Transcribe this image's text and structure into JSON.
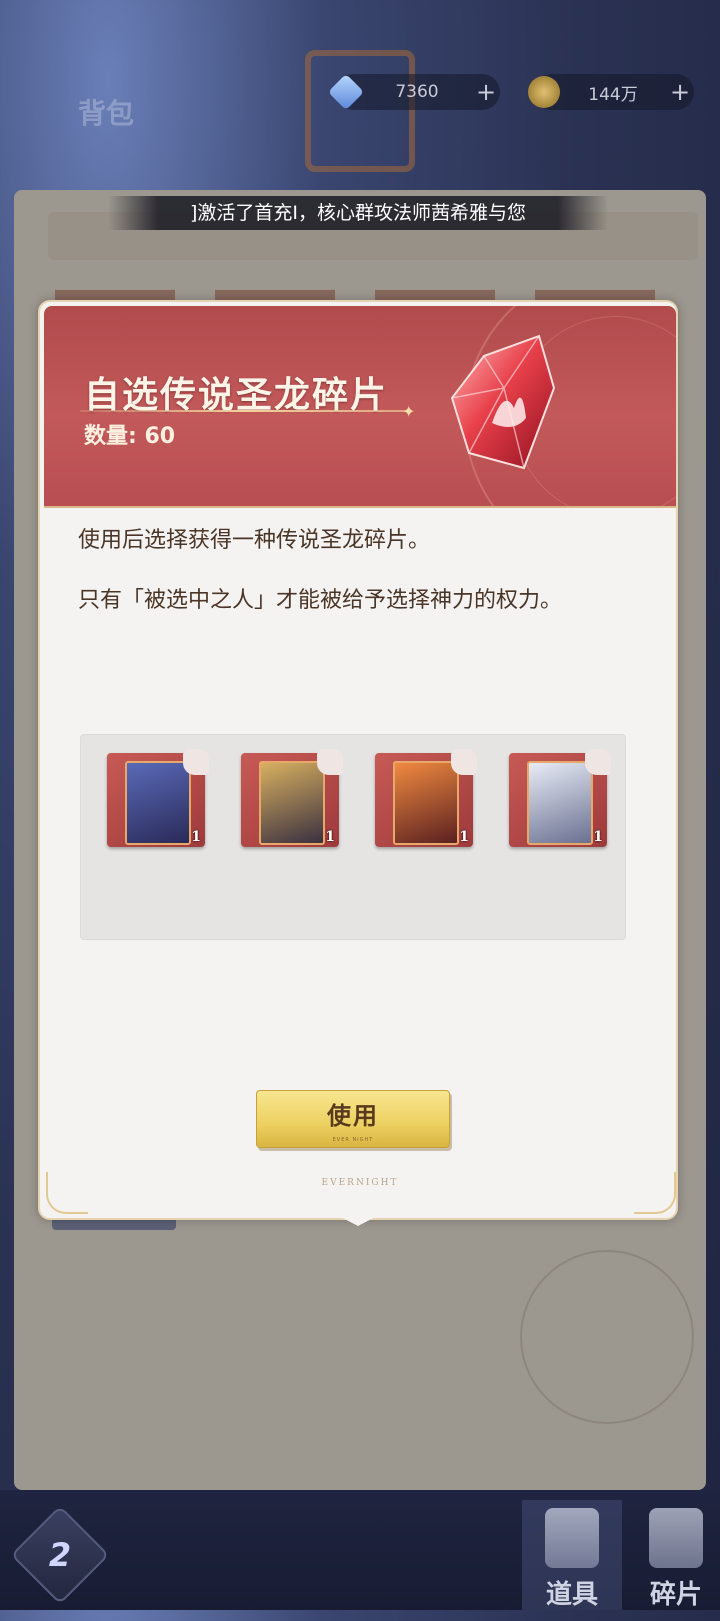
{
  "background": {
    "page_title": "背包",
    "currencies": [
      {
        "icon": "gem-icon",
        "value": "7360",
        "plus": "+"
      },
      {
        "icon": "gold-coin-icon",
        "value": "144万",
        "plus": "+"
      }
    ],
    "tabs": [
      {
        "label": "道具",
        "icon": "item-icon"
      },
      {
        "label": "碎片",
        "icon": "fragment-icon"
      }
    ],
    "logo_text": "2"
  },
  "notice": {
    "text": "]激活了首充Ⅰ，核心群攻法师茜希雅与您"
  },
  "modal": {
    "title": "自选传说圣龙碎片",
    "quantity_label": "数量: 60",
    "description_1": "使用后选择获得一种传说圣龙碎片。",
    "description_2": "只有「被选中之人」才能被给予选择神力的权力。",
    "choices": [
      {
        "name": "dragon-shard-dark",
        "count": "1",
        "art_color": "#3d3f7a"
      },
      {
        "name": "dragon-shard-gold",
        "count": "1",
        "art_color": "#6a4a2a"
      },
      {
        "name": "dragon-shard-fire",
        "count": "1",
        "art_color": "#8a3a20"
      },
      {
        "name": "dragon-shard-white",
        "count": "1",
        "art_color": "#8c8fa8"
      }
    ],
    "use_button": "使用",
    "use_button_sub": "EVER NIGHT",
    "footer_brand": "EVERNIGHT"
  },
  "colors": {
    "header_red": "#c2595a",
    "button_gold": "#edd061",
    "text_brown": "#4a3526"
  }
}
